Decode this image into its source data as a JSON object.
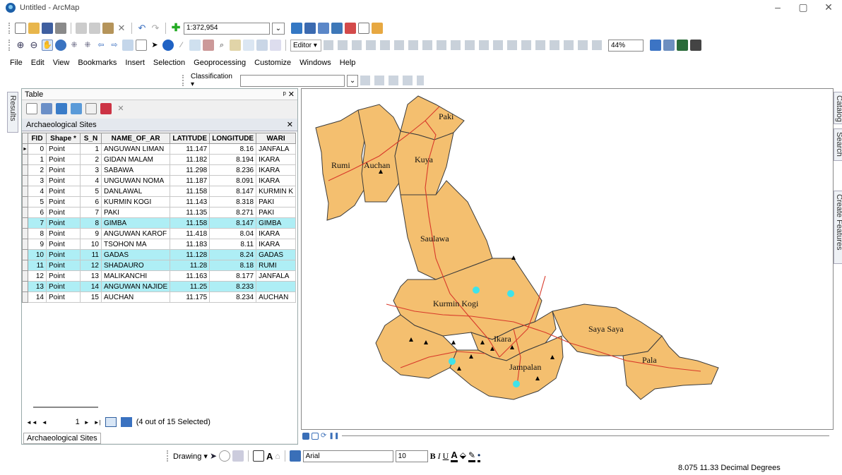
{
  "window": {
    "title": "Untitled - ArcMap",
    "minimize": "–",
    "maximize": "▢",
    "close": "✕"
  },
  "toolbar": {
    "scale_value": "1:372,954",
    "editor_label": "Editor ▾",
    "zoom_percent": "44%",
    "classification_label": "Classification ▾"
  },
  "menu": [
    "File",
    "Edit",
    "View",
    "Bookmarks",
    "Insert",
    "Selection",
    "Geoprocessing",
    "Customize",
    "Windows",
    "Help"
  ],
  "table_panel": {
    "title": "Table",
    "pin": "ᵖ ✕",
    "layer_title": "Archaeological Sites",
    "close": "✕",
    "columns": [
      "FID",
      "Shape *",
      "S_N",
      "NAME_OF_AR",
      "LATITUDE",
      "LONGITUDE",
      "WARI"
    ],
    "rows": [
      [
        "0",
        "Point",
        "1",
        "ANGUWAN LIMAN",
        "11.147",
        "8.16",
        "JANFALA"
      ],
      [
        "1",
        "Point",
        "2",
        "GIDAN MALAM",
        "11.182",
        "8.194",
        "IKARA"
      ],
      [
        "2",
        "Point",
        "3",
        "SABAWA",
        "11.298",
        "8.236",
        "IKARA"
      ],
      [
        "3",
        "Point",
        "4",
        "UNGUWAN NOMA",
        "11.187",
        "8.091",
        "IKARA"
      ],
      [
        "4",
        "Point",
        "5",
        "DANLAWAL",
        "11.158",
        "8.147",
        "KURMIN K"
      ],
      [
        "5",
        "Point",
        "6",
        "KURMIN KOGI",
        "11.143",
        "8.318",
        "PAKI"
      ],
      [
        "6",
        "Point",
        "7",
        "PAKI",
        "11.135",
        "8.271",
        "PAKI"
      ],
      [
        "7",
        "Point",
        "8",
        "GIMBA",
        "11.158",
        "8.147",
        "GIMBA"
      ],
      [
        "8",
        "Point",
        "9",
        "ANGUWAN KAROF",
        "11.418",
        "8.04",
        "IKARA"
      ],
      [
        "9",
        "Point",
        "10",
        "TSOHON MA",
        "11.183",
        "8.11",
        "IKARA"
      ],
      [
        "10",
        "Point",
        "11",
        "GADAS",
        "11.128",
        "8.24",
        "GADAS"
      ],
      [
        "11",
        "Point",
        "12",
        "SHADAURO",
        "11.28",
        "8.18",
        "RUMI"
      ],
      [
        "12",
        "Point",
        "13",
        "MALIKANCHI",
        "11.163",
        "8.177",
        "JANFALA"
      ],
      [
        "13",
        "Point",
        "14",
        "ANGUWAN NAJIDE",
        "11.25",
        "8.233",
        ""
      ],
      [
        "14",
        "Point",
        "15",
        "AUCHAN",
        "11.175",
        "8.234",
        "AUCHAN"
      ]
    ],
    "selected_rows": [
      7,
      10,
      11,
      13
    ],
    "nav_first": "◄◄",
    "nav_prev": "◄",
    "nav_current": "1",
    "nav_next": "►",
    "nav_last": "►|",
    "selection_text": "(4 out of 15 Selected)",
    "bottom_tab": "Archaeological Sites"
  },
  "side_tabs": {
    "left": "Results",
    "right_catalog": "Catalog",
    "right_search": "Search",
    "right_create": "Create Features"
  },
  "map": {
    "labels": [
      "Paki",
      "Rumi",
      "Auchan",
      "Kuya",
      "Saulawa",
      "Kurmin Kogi",
      "Ikara",
      "Saya Saya",
      "Jampalan",
      "Pala"
    ],
    "fill_color": "#f4bf6f",
    "selected_color": "#3fe3ea"
  },
  "drawing_toolbar": {
    "drawing_label": "Drawing ▾",
    "font_name": "Arial",
    "font_size": "10",
    "bold": "B",
    "italic": "I",
    "underline": "U"
  },
  "status_bar": {
    "coords": "8.075  11.33 Decimal Degrees"
  }
}
